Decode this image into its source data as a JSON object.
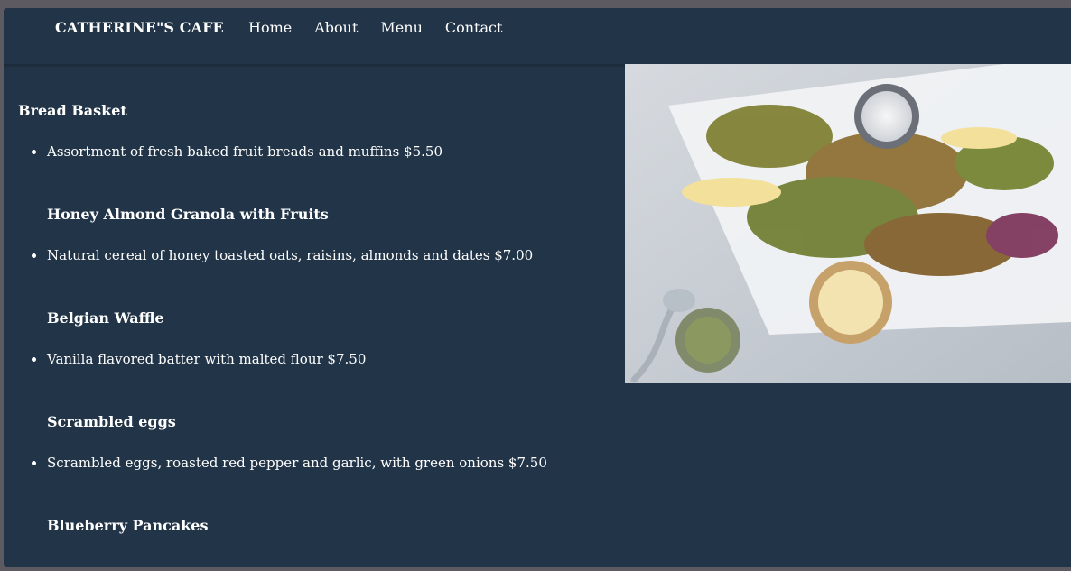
{
  "nav": {
    "brand": "CATHERINE\"S CAFE",
    "links": [
      "Home",
      "About",
      "Menu",
      "Contact"
    ]
  },
  "menu": {
    "sections": [
      {
        "title": "Bread Basket",
        "item": "Assortment of fresh baked fruit breads and muffins $5.50"
      },
      {
        "title": "Honey Almond Granola with Fruits",
        "item": "Natural cereal of honey toasted oats, raisins, almonds and dates $7.00"
      },
      {
        "title": "Belgian Waffle",
        "item": "Vanilla flavored batter with malted flour $7.50"
      },
      {
        "title": "Scrambled eggs",
        "item": "Scrambled eggs, roasted red pepper and garlic, with green onions $7.50"
      },
      {
        "title": "Blueberry Pancakes",
        "item": ""
      }
    ]
  },
  "colors": {
    "background": "#223447",
    "text": "#ffffff",
    "outer": "#5d5b61"
  },
  "icons": {
    "hero": "food-photo"
  }
}
